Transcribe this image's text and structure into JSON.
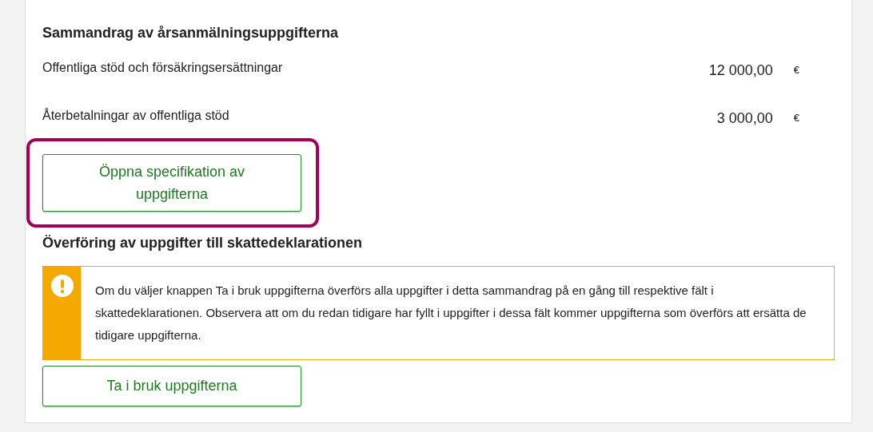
{
  "summary": {
    "title": "Sammandrag av årsanmälningsuppgifterna",
    "rows": [
      {
        "label": "Offentliga stöd och försäkringsersättningar",
        "value": "12 000,00",
        "unit": "€"
      },
      {
        "label": "Återbetalningar av offentliga stöd",
        "value": "3 000,00",
        "unit": "€"
      }
    ],
    "open_button": {
      "label": "Öppna specifikation av uppgifterna",
      "highlighted": true
    }
  },
  "transfer": {
    "title": "Överföring av uppgifter till skattedeklarationen",
    "notice": {
      "kind": "warning",
      "text": "Om du väljer knappen Ta i bruk uppgifterna överförs alla uppgifter i detta sammandrag på en gång till respektive fält i skattedeklarationen. Observera att om du redan tidigare har fyllt i uppgifter i dessa fält kommer uppgifterna som överförs att ersätta de tidigare uppgifterna."
    },
    "apply_button": {
      "label": "Ta i bruk uppgifterna"
    }
  }
}
